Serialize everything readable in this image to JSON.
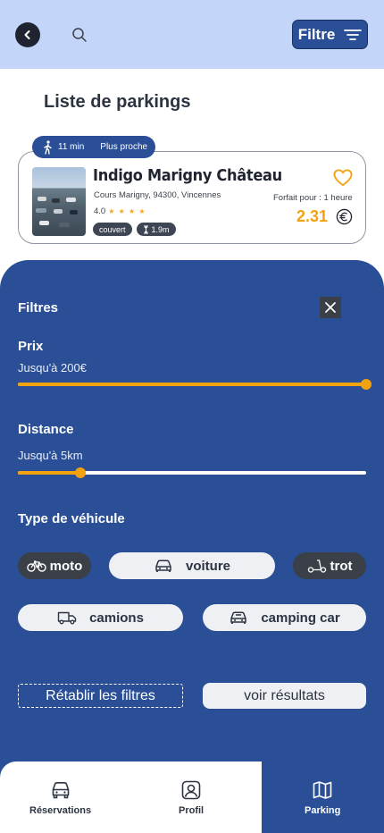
{
  "header": {
    "filter_label": "Filtre"
  },
  "page_title": "Liste de parkings",
  "parking": {
    "walk_time": "11 min",
    "proximity": "Plus proche",
    "name": "Indigo Marigny Château",
    "address": "Cours Marigny, 94300, Vincennes",
    "rating": "4.0",
    "stars": "★ ★ ★ ★",
    "tag_cover": "couvert",
    "tag_height": "1.9m",
    "forfait": "Forfait pour : 1 heure",
    "price": "2.31"
  },
  "filters": {
    "title": "Filtres",
    "price": {
      "title": "Prix",
      "subtitle": "Jusqu'à 200€",
      "level": 1.0
    },
    "distance": {
      "title": "Distance",
      "subtitle": "Jusqu'à 5km",
      "level": 0.18
    },
    "vehicle_title": "Type de véhicule",
    "vehicles": {
      "moto": "moto",
      "voiture": "voiture",
      "trot": "trot",
      "camions": "camions",
      "camping": "camping car"
    },
    "reset_label": "Rétablir les filtres",
    "results_label": "voir résultats"
  },
  "nav": {
    "reservations": "Réservations",
    "profil": "Profil",
    "parking": "Parking"
  },
  "colors": {
    "primary": "#2a4f96",
    "accent": "#f2a20c",
    "header_bg": "#c3d6f9"
  }
}
